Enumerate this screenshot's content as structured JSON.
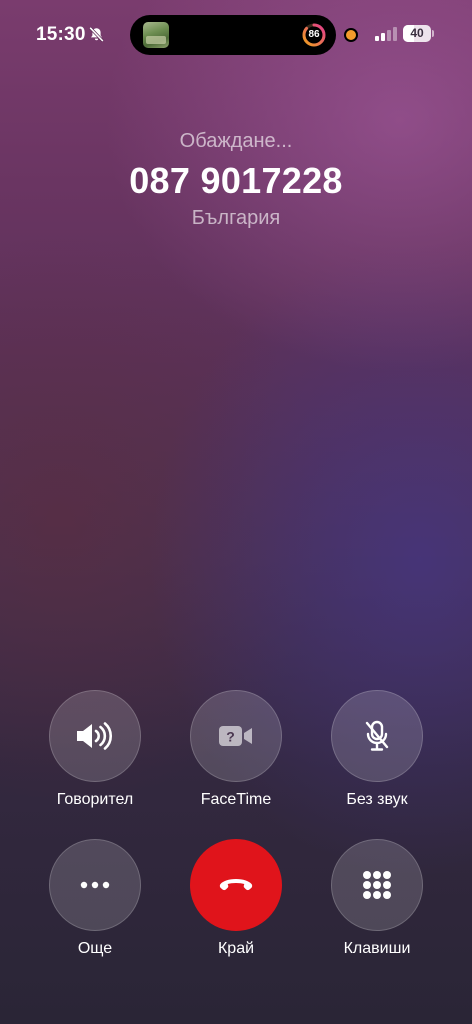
{
  "status_bar": {
    "time": "15:30",
    "activity_ring_value": "86",
    "activity_ring_fraction": 0.86,
    "battery_percent": "40",
    "battery_level": 0.4,
    "icons": [
      "bell-slash-icon",
      "photo-thumbnail",
      "activity-ring",
      "mic-in-use-dot",
      "signal-bars-icon",
      "battery-icon"
    ],
    "colors": {
      "recording_dot": "#f39c2c",
      "ring_start": "#f0a21d",
      "ring_end": "#e23a8f"
    }
  },
  "call": {
    "status": "Обаждане...",
    "number": "087 9017228",
    "location": "България"
  },
  "controls": {
    "speaker": {
      "label": "Говорител",
      "icon": "speaker-wave-icon"
    },
    "facetime": {
      "label": "FaceTime",
      "icon": "facetime-video-icon"
    },
    "mute": {
      "label": "Без звук",
      "icon": "mic-slash-icon"
    },
    "more": {
      "label": "Още",
      "icon": "ellipsis-icon"
    },
    "end": {
      "label": "Край",
      "icon": "phone-hangup-icon",
      "color": "#e0141b"
    },
    "keypad": {
      "label": "Клавиши",
      "icon": "keypad-grid-icon"
    }
  }
}
